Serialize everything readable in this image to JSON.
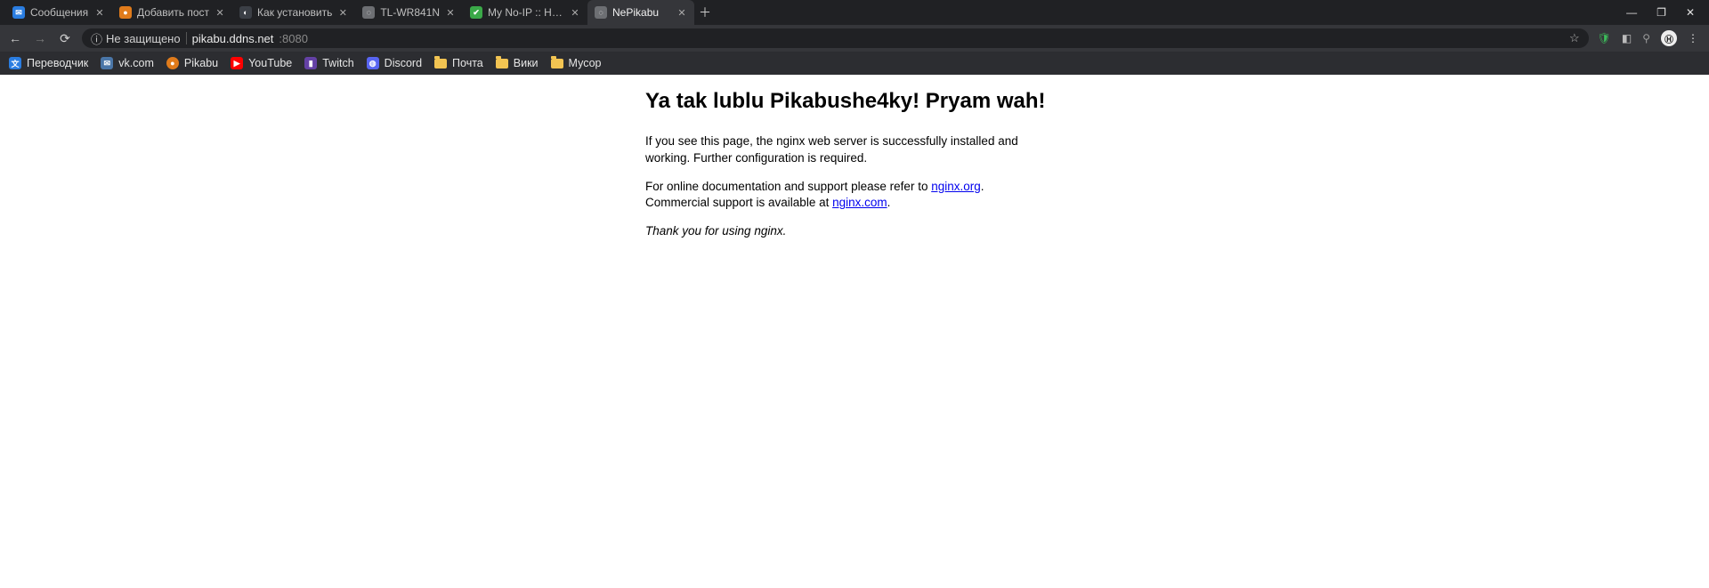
{
  "tabs": [
    {
      "title": "Сообщения",
      "favicon_class": "fc-blue",
      "favicon_glyph": "✉"
    },
    {
      "title": "Добавить пост",
      "favicon_class": "fc-orange",
      "favicon_glyph": "●"
    },
    {
      "title": "Как установить",
      "favicon_class": "fc-gh",
      "favicon_glyph": "◐"
    },
    {
      "title": "TL-WR841N",
      "favicon_class": "fc-globe",
      "favicon_glyph": "◌"
    },
    {
      "title": "My No-IP :: Host",
      "favicon_class": "fc-green",
      "favicon_glyph": "✔"
    },
    {
      "title": "NePikabu",
      "favicon_class": "fc-globe",
      "favicon_glyph": "◌",
      "active": true
    }
  ],
  "tab_close_glyph": "✕",
  "newtab_glyph": "＋",
  "window_controls": {
    "min": "—",
    "max": "❐",
    "close": "✕"
  },
  "toolbar": {
    "back": "←",
    "forward": "→",
    "reload": "⟳",
    "security_icon": "ⓘ",
    "security_text": "Не защищено",
    "url_host": "pikabu.ddns.net",
    "url_port": ":8080",
    "star": "☆",
    "ext_shield": "🛡",
    "ext_evernote": "◧",
    "ext_location": "⚲",
    "ext_badge": "Ⓗ",
    "menu": "⋮"
  },
  "bookmarks": [
    {
      "label": "Переводчик",
      "icon_class": "fc-trans",
      "glyph": "文"
    },
    {
      "label": "vk.com",
      "icon_class": "fc-vk",
      "glyph": "✉"
    },
    {
      "label": "Pikabu",
      "icon_class": "fc-pika",
      "glyph": "●"
    },
    {
      "label": "YouTube",
      "icon_class": "fc-yt",
      "glyph": "▶"
    },
    {
      "label": "Twitch",
      "icon_class": "fc-twitch",
      "glyph": "▮"
    },
    {
      "label": "Discord",
      "icon_class": "fc-disc",
      "glyph": "◍"
    },
    {
      "label": "Почта",
      "folder": true
    },
    {
      "label": "Вики",
      "folder": true
    },
    {
      "label": "Мусор",
      "folder": true
    }
  ],
  "page": {
    "heading": "Ya tak lublu Pikabushe4ky! Pryam wah!",
    "p1": "If you see this page, the nginx web server is successfully installed and working. Further configuration is required.",
    "p2a": "For online documentation and support please refer to ",
    "p2_link1": "nginx.org",
    "p2b": ".",
    "p3a": "Commercial support is available at ",
    "p3_link": "nginx.com",
    "p3b": ".",
    "thanks": "Thank you for using nginx."
  }
}
